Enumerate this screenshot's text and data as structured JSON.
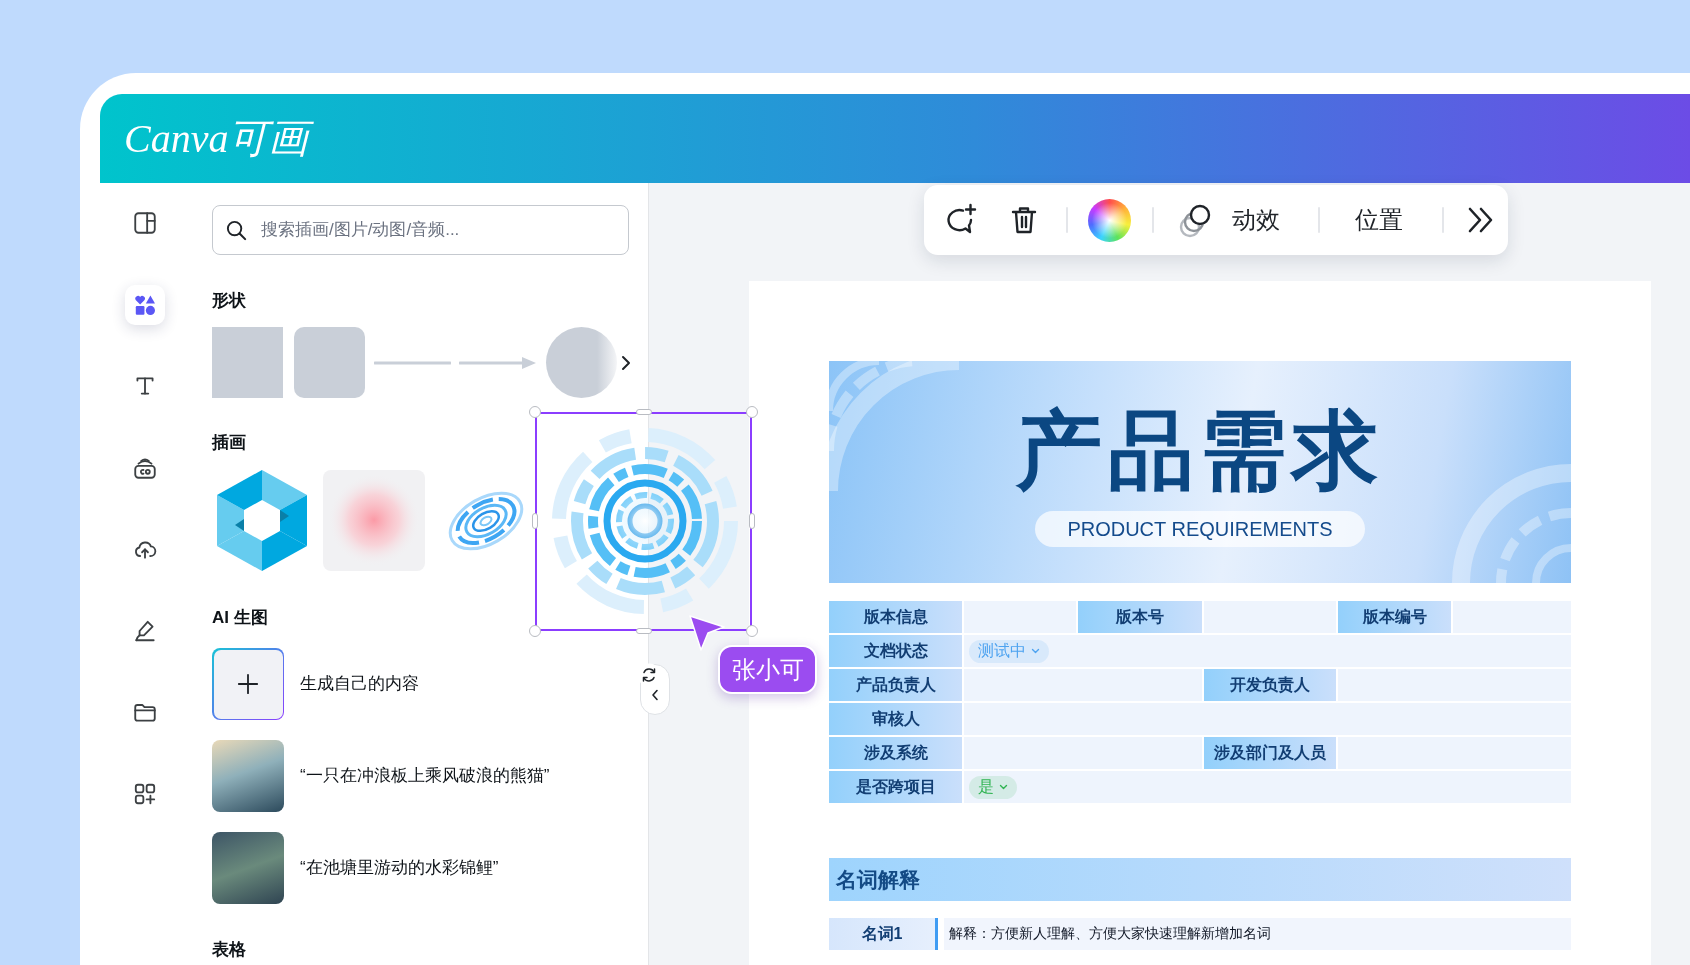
{
  "header": {
    "logo": "Canva可画"
  },
  "sidebar": {
    "items": [
      {
        "selected": false
      },
      {
        "selected": true
      },
      {
        "selected": false
      },
      {
        "selected": false
      },
      {
        "selected": false
      },
      {
        "selected": false
      },
      {
        "selected": false
      },
      {
        "selected": false
      }
    ]
  },
  "panel": {
    "search": {
      "placeholder": "搜索插画/图片/动图/音频..."
    },
    "sections": [
      {
        "kind": "shapes",
        "title": "形状"
      },
      {
        "kind": "illustrations",
        "title": "插画",
        "items": [
          {
            "selected": false
          },
          {
            "selected": false
          },
          {
            "selected": false
          },
          {
            "selected": true
          }
        ]
      },
      {
        "kind": "ai",
        "title": "AI 生图",
        "items": [
          {
            "kind": "create",
            "text": "生成自己的内容"
          },
          {
            "kind": "prompt",
            "text": "“一只在冲浪板上乘风破浪的熊猫”"
          },
          {
            "kind": "prompt",
            "text": "“在池塘里游动的水彩锦鲤”"
          }
        ]
      },
      {
        "kind": "tables",
        "title": "表格"
      }
    ]
  },
  "toolbar": {
    "animate": "动效",
    "position": "位置"
  },
  "collaborator": {
    "name": "张小可"
  },
  "document": {
    "title": "产品需求",
    "subtitle": "PRODUCT REQUIREMENTS",
    "info_table": {
      "rows": [
        {
          "cells": [
            {
              "kind": "label",
              "text": "版本信息"
            },
            {
              "kind": "blank"
            },
            {
              "kind": "label",
              "text": "版本号"
            },
            {
              "kind": "blank"
            },
            {
              "kind": "label",
              "text": "版本编号"
            },
            {
              "kind": "blank"
            }
          ]
        },
        {
          "cells": [
            {
              "kind": "label",
              "text": "文档状态"
            },
            {
              "kind": "select",
              "text": "测试中",
              "color": "#4da3f0"
            }
          ]
        },
        {
          "cells": [
            {
              "kind": "label",
              "text": "产品负责人"
            },
            {
              "kind": "blank"
            },
            {
              "kind": "label",
              "text": "开发负责人"
            },
            {
              "kind": "blank"
            }
          ]
        },
        {
          "cells": [
            {
              "kind": "label",
              "text": "审核人"
            },
            {
              "kind": "blank"
            }
          ]
        },
        {
          "cells": [
            {
              "kind": "label",
              "text": "涉及系统"
            },
            {
              "kind": "blank"
            },
            {
              "kind": "label",
              "text": "涉及部门及人员"
            },
            {
              "kind": "blank"
            }
          ]
        },
        {
          "cells": [
            {
              "kind": "label",
              "text": "是否跨项目"
            },
            {
              "kind": "select",
              "text": "是",
              "color": "#2fb351"
            }
          ]
        }
      ]
    },
    "glossary": {
      "title": "名词解释",
      "rows": [
        {
          "term": "名词1",
          "definition": "解释：方便新人理解、方便大家快速理解新增加名词"
        }
      ]
    }
  }
}
